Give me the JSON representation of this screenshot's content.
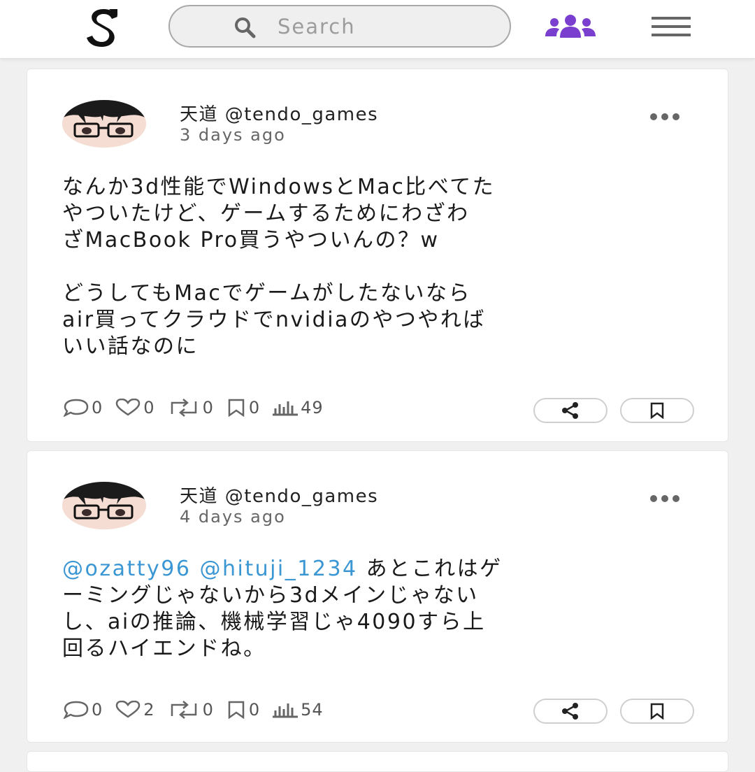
{
  "header": {
    "logo_icon": "s-logo-icon",
    "search": {
      "placeholder": "Search",
      "value": "",
      "icon": "search-icon"
    },
    "people_icon": "users-icon",
    "people_icon_color": "#7b3fd0",
    "menu_icon": "hamburger-menu-icon"
  },
  "posts": [
    {
      "author": "天道 @tendo_games",
      "time": "3 days ago",
      "paragraphs": [
        "なんか3d性能でWindowsとMac比べてた\nやついたけど、ゲームするためにわざわ\nざMacBook Pro買うやついんの？w",
        "どうしてもMacでゲームがしたないなら\nair買ってクラウドでnvidiaのやつやれば\nいい話なのに"
      ],
      "comments": "0",
      "likes": "0",
      "reposts": "0",
      "bookmarks": "0",
      "views": "49"
    },
    {
      "author": "天道 @tendo_games",
      "time": "4 days ago",
      "mentions": "@ozatty96 @hituji_1234",
      "text": " あとこれはゲ\nーミングじゃないから3dメインじゃない\nし、aiの推論、機械学習じゃ4090すら上\n回るハイエンドね。",
      "comments": "0",
      "likes": "2",
      "reposts": "0",
      "bookmarks": "0",
      "views": "54"
    }
  ],
  "colors": {
    "mention": "#3b97d3",
    "icon_gray": "#666666",
    "background": "#f0f0f0"
  }
}
